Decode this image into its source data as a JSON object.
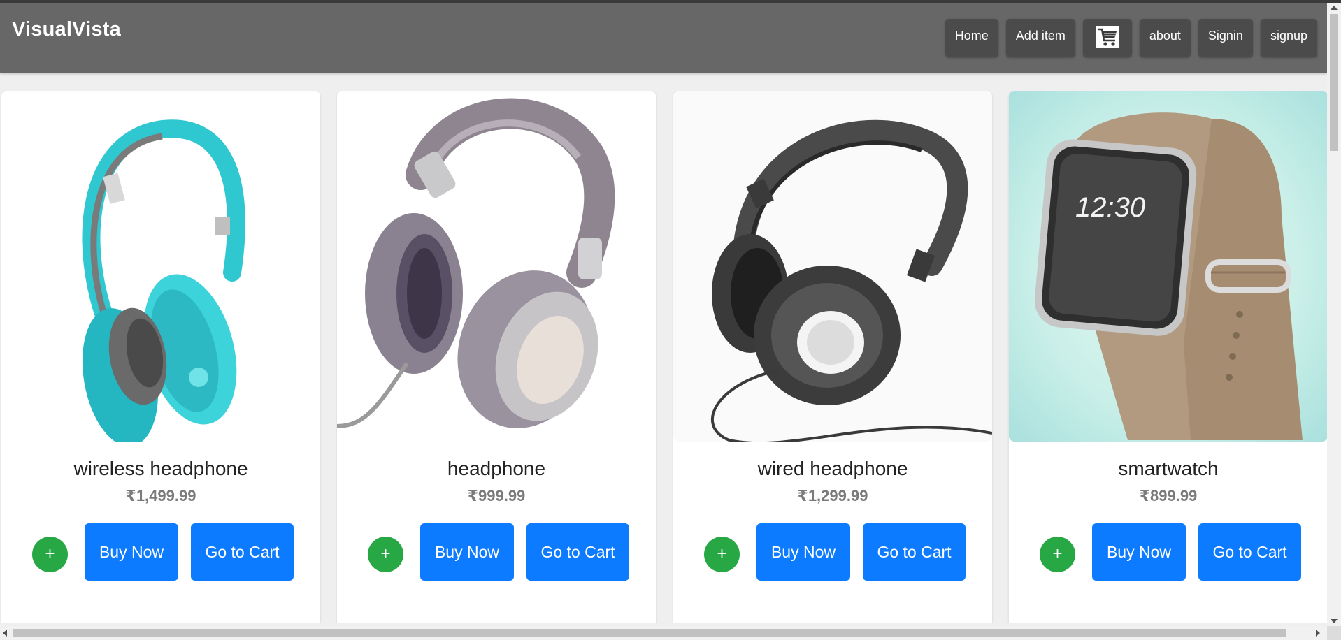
{
  "header": {
    "brand": "VisualVista",
    "nav": {
      "home": "Home",
      "add_item": "Add item",
      "cart_icon": "shopping-cart-icon",
      "about": "about",
      "signin": "Signin",
      "signup": "signup"
    }
  },
  "products": [
    {
      "title": "wireless headphone",
      "price": "₹1,499.99",
      "image": "teal-wireless-headphone",
      "add_label": "+",
      "buy_label": "Buy Now",
      "cart_label": "Go to Cart"
    },
    {
      "title": "headphone",
      "price": "₹999.99",
      "image": "gray-studio-headphone",
      "add_label": "+",
      "buy_label": "Buy Now",
      "cart_label": "Go to Cart"
    },
    {
      "title": "wired headphone",
      "price": "₹1,299.99",
      "image": "black-wired-headphone",
      "add_label": "+",
      "buy_label": "Buy Now",
      "cart_label": "Go to Cart"
    },
    {
      "title": "smartwatch",
      "price": "₹899.99",
      "image": "smartwatch-leather-band",
      "watch_time": "12:30",
      "add_label": "+",
      "buy_label": "Buy Now",
      "cart_label": "Go to Cart"
    }
  ],
  "colors": {
    "header_bg": "#676767",
    "nav_button_bg": "#4b4b4b",
    "primary_button": "#0d7bff",
    "add_button": "#28a745",
    "price_text": "#7b7b7b",
    "page_bg": "#efefef"
  }
}
